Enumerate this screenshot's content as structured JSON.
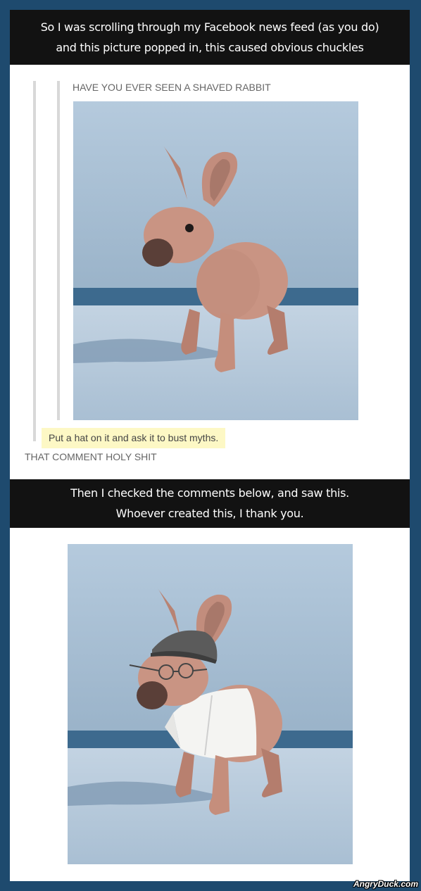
{
  "banner_top": {
    "line1": "So I was scrolling through my Facebook news feed (as you do)",
    "line2": "and this picture popped in, this caused obvious chuckles"
  },
  "post": {
    "title": "HAVE YOU EVER SEEN A SHAVED RABBIT",
    "highlighted_comment": "Put a hat on it and ask it to bust myths.",
    "reblog_comment": "THAT COMMENT HOLY SHIT"
  },
  "banner_bottom": {
    "line1": "Then I checked the comments below, and saw this.",
    "line2": "Whoever created this, I thank you."
  },
  "watermark": "AngryDuck.com",
  "colors": {
    "page_background": "#1e4a6e",
    "banner_background": "#121212",
    "highlight": "#fdf8c5",
    "backdrop": "#a9c1d6",
    "rabbit_skin": "#c99483"
  }
}
